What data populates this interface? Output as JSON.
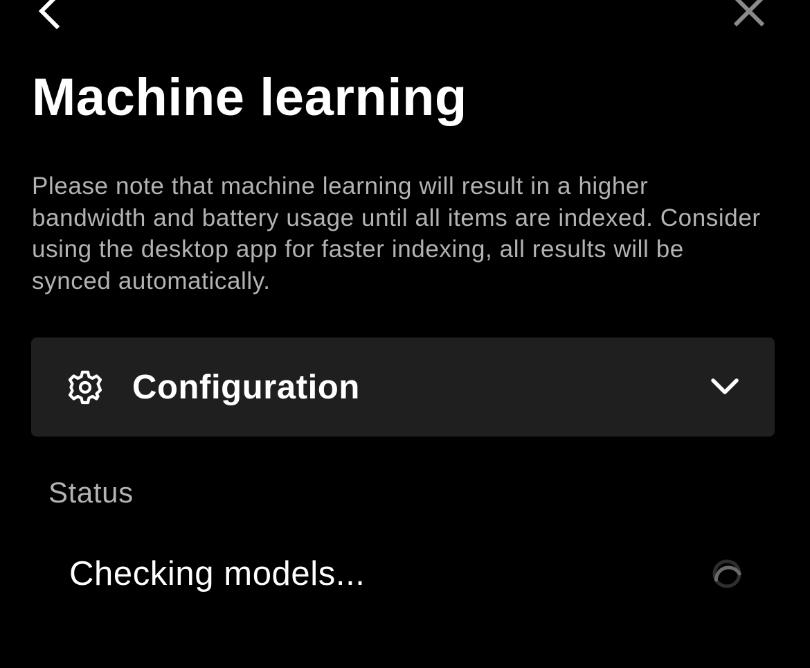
{
  "header": {
    "back_icon": "chevron-left-icon",
    "close_icon": "close-icon",
    "title": "Machine learning"
  },
  "description": "Please note that machine learning will result in a higher bandwidth and battery usage until all items are indexed. Consider using the desktop app for faster indexing, all results will be synced automatically.",
  "configuration": {
    "icon": "gear-icon",
    "label": "Configuration",
    "expand_icon": "chevron-down-icon"
  },
  "status": {
    "section_label": "Status",
    "message": "Checking models...",
    "indicator_icon": "spinner-icon"
  },
  "colors": {
    "background": "#000000",
    "card_background": "#1f1f1f",
    "primary_text": "#ffffff",
    "secondary_text": "#b3b3b3",
    "close_icon": "#8a8a8a",
    "spinner_track": "#2e2e2e",
    "spinner_arc": "#6a6a6a"
  }
}
